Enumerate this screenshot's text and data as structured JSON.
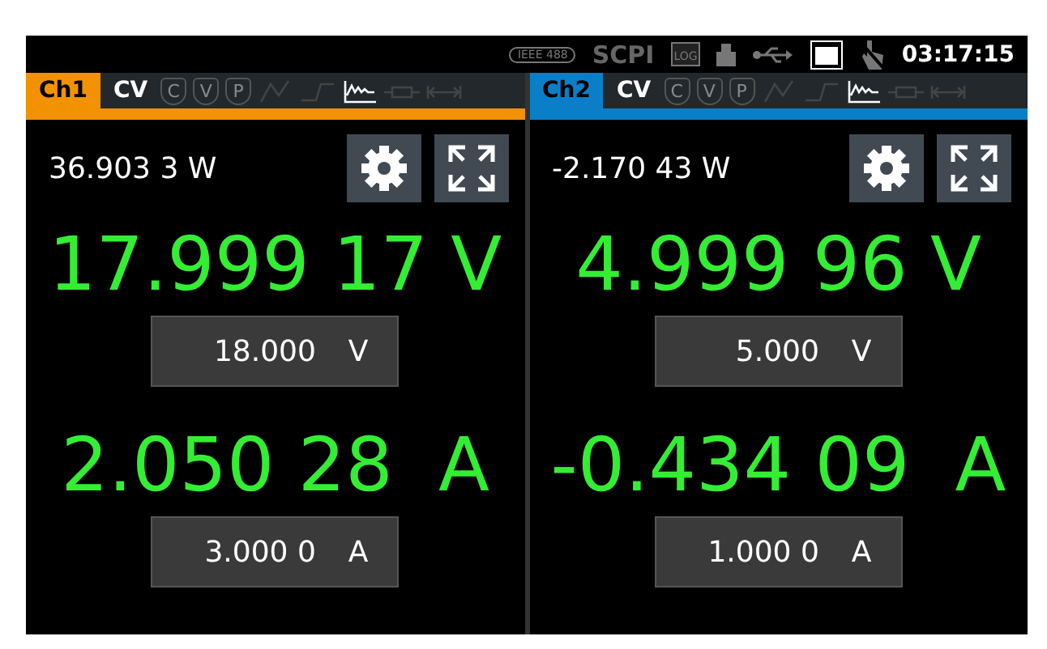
{
  "status_bar": {
    "interfaces": [
      {
        "kind": "ieee",
        "label": "IEEE 488",
        "active": false
      },
      {
        "kind": "text",
        "label": "SCPI",
        "active": false
      },
      {
        "kind": "log",
        "label": "LOG",
        "active": false
      },
      {
        "kind": "stick",
        "active": false
      },
      {
        "kind": "usb",
        "active": false
      },
      {
        "kind": "lan",
        "active": true
      },
      {
        "kind": "touch",
        "active": false
      }
    ],
    "time": "03:17:15"
  },
  "channels": [
    {
      "name": "Ch1",
      "color": "#f39200",
      "mode": "CV",
      "modes": [
        {
          "kind": "shield",
          "label": "C",
          "active": false
        },
        {
          "kind": "shield",
          "label": "V",
          "active": false
        },
        {
          "kind": "shield",
          "label": "P",
          "active": false
        },
        {
          "kind": "ramp",
          "active": false
        },
        {
          "kind": "step",
          "active": false
        },
        {
          "kind": "logging",
          "active": true
        },
        {
          "kind": "resistor",
          "active": false
        },
        {
          "kind": "arrows",
          "active": false
        }
      ],
      "power": "36.903 3 W",
      "voltage": {
        "value": "17.999 17",
        "unit": "V",
        "set": "18.000",
        "set_unit": "V"
      },
      "current": {
        "value": "2.050 28",
        "unit": "A",
        "set": "3.000 0",
        "set_unit": "A"
      }
    },
    {
      "name": "Ch2",
      "color": "#0a7fc8",
      "mode": "CV",
      "modes": [
        {
          "kind": "shield",
          "label": "C",
          "active": false
        },
        {
          "kind": "shield",
          "label": "V",
          "active": false
        },
        {
          "kind": "shield",
          "label": "P",
          "active": false
        },
        {
          "kind": "ramp",
          "active": false
        },
        {
          "kind": "step",
          "active": false
        },
        {
          "kind": "logging",
          "active": true
        },
        {
          "kind": "resistor",
          "active": false
        },
        {
          "kind": "arrows",
          "active": false
        }
      ],
      "power": "-2.170 43 W",
      "voltage": {
        "value": "4.999 96",
        "unit": "V",
        "set": "5.000",
        "set_unit": "V"
      },
      "current": {
        "value": "-0.434 09",
        "unit": "A",
        "set": "1.000 0",
        "set_unit": "A"
      }
    }
  ]
}
